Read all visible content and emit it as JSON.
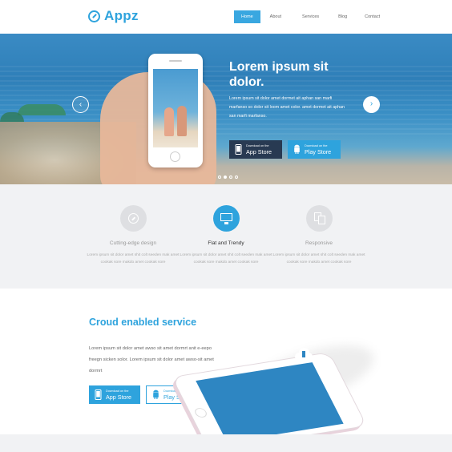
{
  "header": {
    "logo_text": "Appz",
    "nav": [
      "Home",
      "About",
      "Services",
      "Blog",
      "Contact"
    ]
  },
  "hero": {
    "title": "Lorem ipsum sit dolor.",
    "text": "Lorem ipsum sit dolor amet dormet ait aphan san marfi marfanso so dolor sit loom amet color. amet dormet ait aphan san marfi marfanso.",
    "app_store": {
      "small": "Download on the",
      "big": "App Store"
    },
    "play_store": {
      "small": "Download on the",
      "big": "Play Store"
    },
    "slide_count": 4,
    "active_slide": 2
  },
  "features": [
    {
      "name": "Cutting-edge design",
      "desc": "Lorem ipsum sit dolor amet shit colt seeden mak amet cookak sore makdo amet cookak sore"
    },
    {
      "name": "Flat and Trendy",
      "desc": "Lorem ipsum sit dolor amet shit colt seeden mak amet cookak sore makdo amet cookak sore"
    },
    {
      "name": "Responsive",
      "desc": "Lorem ipsum sit dolor amet shit colt seeden mak amet cookak sore makdo amet cookak sore"
    }
  ],
  "cloud": {
    "title": "Croud enabled service",
    "text": "Lorem ipsum sit dolor amet awso sit amet dormrt anit e-eepo freegn sicken solor. Lorem ipsum sit dolor amet awso-sit amet dormrt",
    "app_store": {
      "small": "Download on the",
      "big": "App Store"
    },
    "play_store": {
      "small": "Download on the",
      "big": "Play Store"
    }
  },
  "colors": {
    "accent": "#2ea3dd",
    "dark_button": "#283a52"
  }
}
